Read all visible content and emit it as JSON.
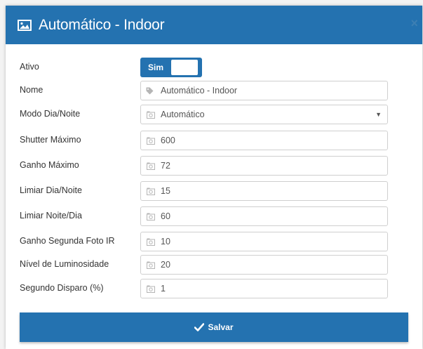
{
  "header": {
    "title": "Automático - Indoor",
    "close": "×"
  },
  "form": {
    "ativo": {
      "label": "Ativo",
      "toggle_text": "Sim"
    },
    "nome": {
      "label": "Nome",
      "value": "Automático - Indoor"
    },
    "modo": {
      "label": "Modo Dia/Noite",
      "value": "Automático",
      "caret": "▼"
    },
    "shutter": {
      "label": "Shutter Máximo",
      "value": "600"
    },
    "ganho": {
      "label": "Ganho Máximo",
      "value": "72"
    },
    "limiar_dn": {
      "label": "Limiar Dia/Noite",
      "value": "15"
    },
    "limiar_nd": {
      "label": "Limiar Noite/Dia",
      "value": "60"
    },
    "ganho_ir": {
      "label": "Ganho Segunda Foto IR",
      "value": "10"
    },
    "luminosidade": {
      "label": "Nível de Luminosidade",
      "value": "20"
    },
    "disparo": {
      "label": "Segundo Disparo (%)",
      "value": "1"
    }
  },
  "save_label": "Salvar",
  "icons": {
    "title": "image-icon",
    "tag": "tag-icon",
    "field": "camera-icon",
    "save": "check-icon"
  },
  "colors": {
    "primary": "#2472b0",
    "field_border": "#cfcfcf",
    "icon_gray": "#b5b5b5"
  }
}
